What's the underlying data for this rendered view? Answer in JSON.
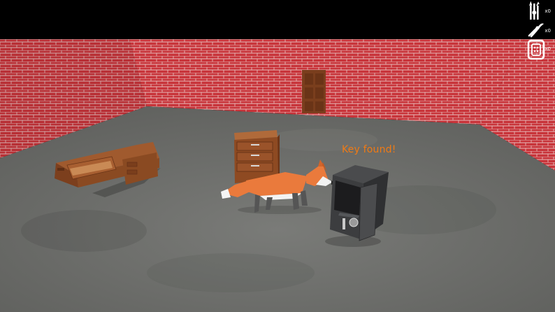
{
  "hud": {
    "inventory": [
      {
        "item": "lockpicks-icon",
        "count": "x0"
      },
      {
        "item": "pliers-icon",
        "count": "x0"
      },
      {
        "item": "keypad-icon",
        "count": "x0"
      }
    ]
  },
  "message": "Key found!",
  "colors": {
    "brick": "#c8343a",
    "floor": "#727370",
    "wood": "#8e4a22",
    "fox": "#ea7a3c",
    "safe": "#3c3d3f",
    "message": "#f07a14"
  }
}
